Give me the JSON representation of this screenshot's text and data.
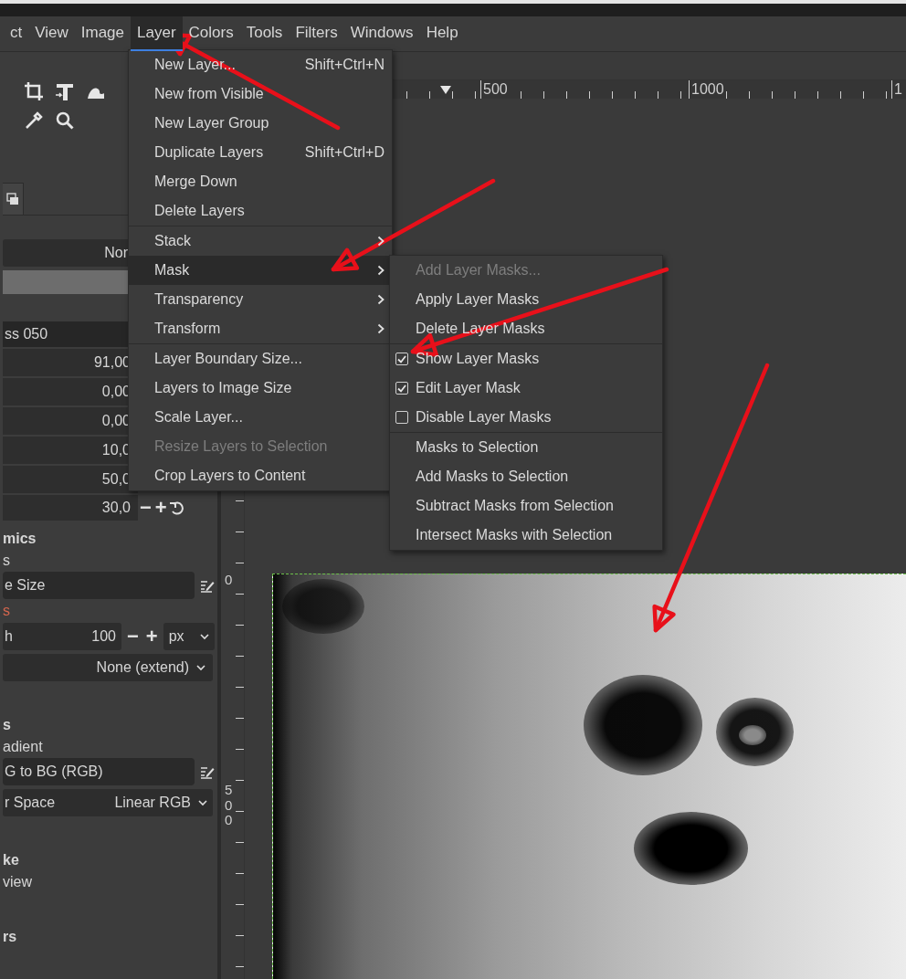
{
  "menubar": [
    {
      "label": "ct",
      "selected": false
    },
    {
      "label": "View",
      "selected": false
    },
    {
      "label": "Image",
      "selected": false
    },
    {
      "label": "Layer",
      "selected": true
    },
    {
      "label": "Colors",
      "selected": false
    },
    {
      "label": "Tools",
      "selected": false
    },
    {
      "label": "Filters",
      "selected": false
    },
    {
      "label": "Windows",
      "selected": false
    },
    {
      "label": "Help",
      "selected": false
    }
  ],
  "layer_menu": {
    "groups": [
      [
        {
          "kind": "item",
          "label": "New Layer...",
          "shortcut": "Shift+Ctrl+N",
          "selected": false,
          "disabled": false
        },
        {
          "kind": "item",
          "label": "New from Visible",
          "selected": false,
          "disabled": false
        },
        {
          "kind": "item",
          "label": "New Layer Group",
          "selected": false,
          "disabled": false
        },
        {
          "kind": "item",
          "label": "Duplicate Layers",
          "shortcut": "Shift+Ctrl+D",
          "selected": false,
          "disabled": false
        },
        {
          "kind": "item",
          "label": "Merge Down",
          "selected": false,
          "disabled": false
        },
        {
          "kind": "item",
          "label": "Delete Layers",
          "selected": false,
          "disabled": false
        }
      ],
      [
        {
          "kind": "submenu",
          "label": "Stack",
          "selected": false,
          "disabled": false
        },
        {
          "kind": "submenu",
          "label": "Mask",
          "selected": true,
          "disabled": false
        },
        {
          "kind": "submenu",
          "label": "Transparency",
          "selected": false,
          "disabled": false
        },
        {
          "kind": "submenu",
          "label": "Transform",
          "selected": false,
          "disabled": false
        }
      ],
      [
        {
          "kind": "item",
          "label": "Layer Boundary Size...",
          "selected": false,
          "disabled": false
        },
        {
          "kind": "item",
          "label": "Layers to Image Size",
          "selected": false,
          "disabled": false
        },
        {
          "kind": "item",
          "label": "Scale Layer...",
          "selected": false,
          "disabled": false
        },
        {
          "kind": "item",
          "label": "Resize Layers to Selection",
          "selected": false,
          "disabled": true
        },
        {
          "kind": "item",
          "label": "Crop Layers to Content",
          "selected": false,
          "disabled": false
        }
      ]
    ]
  },
  "mask_menu": {
    "groups": [
      [
        {
          "kind": "item",
          "label": "Add Layer Masks...",
          "disabled": true
        },
        {
          "kind": "item",
          "label": "Apply Layer Masks",
          "disabled": false
        },
        {
          "kind": "item",
          "label": "Delete Layer Masks",
          "disabled": false
        }
      ],
      [
        {
          "kind": "check",
          "label": "Show Layer Masks",
          "checked": true,
          "disabled": false
        },
        {
          "kind": "check",
          "label": "Edit Layer Mask",
          "checked": true,
          "disabled": false
        },
        {
          "kind": "check",
          "label": "Disable Layer Masks",
          "checked": false,
          "disabled": false
        }
      ],
      [
        {
          "kind": "item",
          "label": "Masks to Selection",
          "disabled": false
        },
        {
          "kind": "item",
          "label": "Add Masks to Selection",
          "disabled": false
        },
        {
          "kind": "item",
          "label": "Subtract Masks from Selection",
          "disabled": false
        },
        {
          "kind": "item",
          "label": "Intersect Masks with Selection",
          "disabled": false
        }
      ]
    ]
  },
  "tool_options": [
    {
      "kind": "dropdown",
      "value": "Nor"
    },
    {
      "kind": "slider"
    },
    {
      "kind": "field",
      "value": "ss 050"
    },
    {
      "kind": "number",
      "value": "91,00"
    },
    {
      "kind": "number",
      "value": "0,00"
    },
    {
      "kind": "number",
      "value": "0,00"
    },
    {
      "kind": "number",
      "value": "10,0"
    },
    {
      "kind": "number",
      "value": "50,0"
    },
    {
      "kind": "number_reset",
      "value": "30,0",
      "minus": "−",
      "plus": "+"
    },
    {
      "kind": "heading",
      "text": "mics"
    },
    {
      "kind": "label",
      "text": "s"
    },
    {
      "kind": "resource",
      "value": "e Size"
    },
    {
      "kind": "accent_label",
      "text": "s"
    },
    {
      "kind": "size",
      "label": "h",
      "value": "100",
      "minus": "−",
      "plus": "+",
      "unit": "px"
    },
    {
      "kind": "dropdown",
      "value": "None (extend)"
    },
    {
      "kind": "heading",
      "text": "s"
    },
    {
      "kind": "label",
      "text": "adient"
    },
    {
      "kind": "resource",
      "value": "G to BG (RGB)"
    },
    {
      "kind": "labeled_dropdown",
      "label": "r Space",
      "value": "Linear RGB"
    },
    {
      "kind": "heading",
      "text": "ke"
    },
    {
      "kind": "label",
      "text": "view"
    },
    {
      "kind": "heading",
      "text": "rs"
    }
  ],
  "horizontal_ruler": {
    "labels": [
      "500",
      "1000",
      "1"
    ]
  },
  "vertical_ruler": {
    "labels": [
      "0",
      "500"
    ]
  }
}
